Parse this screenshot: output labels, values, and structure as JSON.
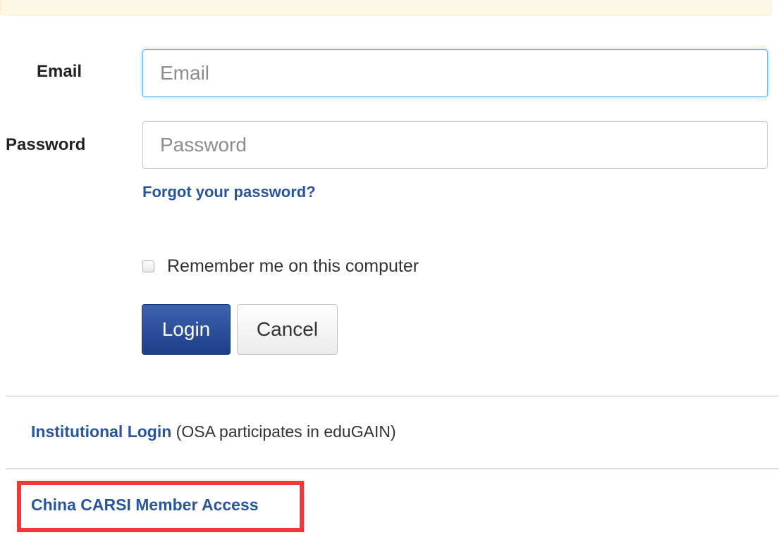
{
  "form": {
    "email_label": "Email",
    "email_placeholder": "Email",
    "password_label": "Password",
    "password_placeholder": "Password",
    "forgot_password_link": "Forgot your password?",
    "remember_me_label": "Remember me on this computer",
    "remember_me_checked": false,
    "login_button": "Login",
    "cancel_button": "Cancel"
  },
  "alternative_logins": {
    "institutional_link": "Institutional Login",
    "institutional_note": " (OSA participates in eduGAIN)",
    "carsi_link": "China CARSI Member Access"
  },
  "colors": {
    "link": "#2a5599",
    "primary_button": "#2a4d9b",
    "highlight_box": "#f0383a",
    "focus_border": "#66afe9"
  }
}
